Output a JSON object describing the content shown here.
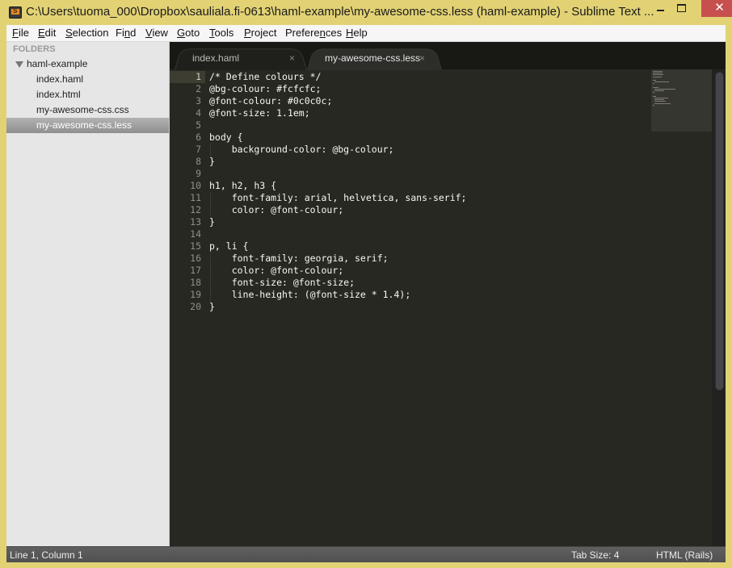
{
  "window": {
    "title": "C:\\Users\\tuoma_000\\Dropbox\\sauliala.fi-0613\\haml-example\\my-awesome-css.less (haml-example) - Sublime Text ...",
    "app_icon_glyph": "S",
    "close_glyph": "✕"
  },
  "menu": [
    {
      "label": "File",
      "accel": "F",
      "rest": "ile"
    },
    {
      "label": "Edit",
      "accel": "E",
      "rest": "dit"
    },
    {
      "label": "Selection",
      "accel": "S",
      "rest": "election"
    },
    {
      "label": "Find",
      "pre": "Fi",
      "accel": "n",
      "rest": "d"
    },
    {
      "label": "View",
      "accel": "V",
      "rest": "iew"
    },
    {
      "label": "Goto",
      "accel": "G",
      "rest": "oto"
    },
    {
      "label": "Tools",
      "accel": "T",
      "rest": "ools"
    },
    {
      "label": "Project",
      "accel": "P",
      "rest": "roject"
    },
    {
      "label": "Preferences",
      "pre": "Prefere",
      "accel": "n",
      "rest": "ces"
    },
    {
      "label": "Help",
      "accel": "H",
      "rest": "elp"
    }
  ],
  "sidebar": {
    "header": "FOLDERS",
    "folder": "haml-example",
    "files": [
      {
        "name": "index.haml",
        "selected": false
      },
      {
        "name": "index.html",
        "selected": false
      },
      {
        "name": "my-awesome-css.css",
        "selected": false
      },
      {
        "name": "my-awesome-css.less",
        "selected": true
      }
    ]
  },
  "tabs": [
    {
      "label": "index.haml",
      "active": false,
      "close": "×"
    },
    {
      "label": "my-awesome-css.less",
      "active": true,
      "close": "×"
    }
  ],
  "editor": {
    "current_line": 1,
    "lines": [
      "/* Define colours */",
      "@bg-colour: #fcfcfc;",
      "@font-colour: #0c0c0c;",
      "@font-size: 1.1em;",
      "",
      "body {",
      "    background-color: @bg-colour;",
      "}",
      "",
      "h1, h2, h3 {",
      "    font-family: arial, helvetica, sans-serif;",
      "    color: @font-colour;",
      "}",
      "",
      "p, li {",
      "    font-family: georgia, serif;",
      "    color: @font-colour;",
      "    font-size: @font-size;",
      "    line-height: (@font-size * 1.4);",
      "}"
    ]
  },
  "status": {
    "position": "Line 1, Column 1",
    "tab_size": "Tab Size: 4",
    "syntax": "HTML (Rails)"
  },
  "colors": {
    "window_frame": "#e2d274",
    "editor_bg": "#272822",
    "close_button": "#c7504f",
    "code_text": "#f8f8f2",
    "line_numbers": "#8f908a"
  }
}
